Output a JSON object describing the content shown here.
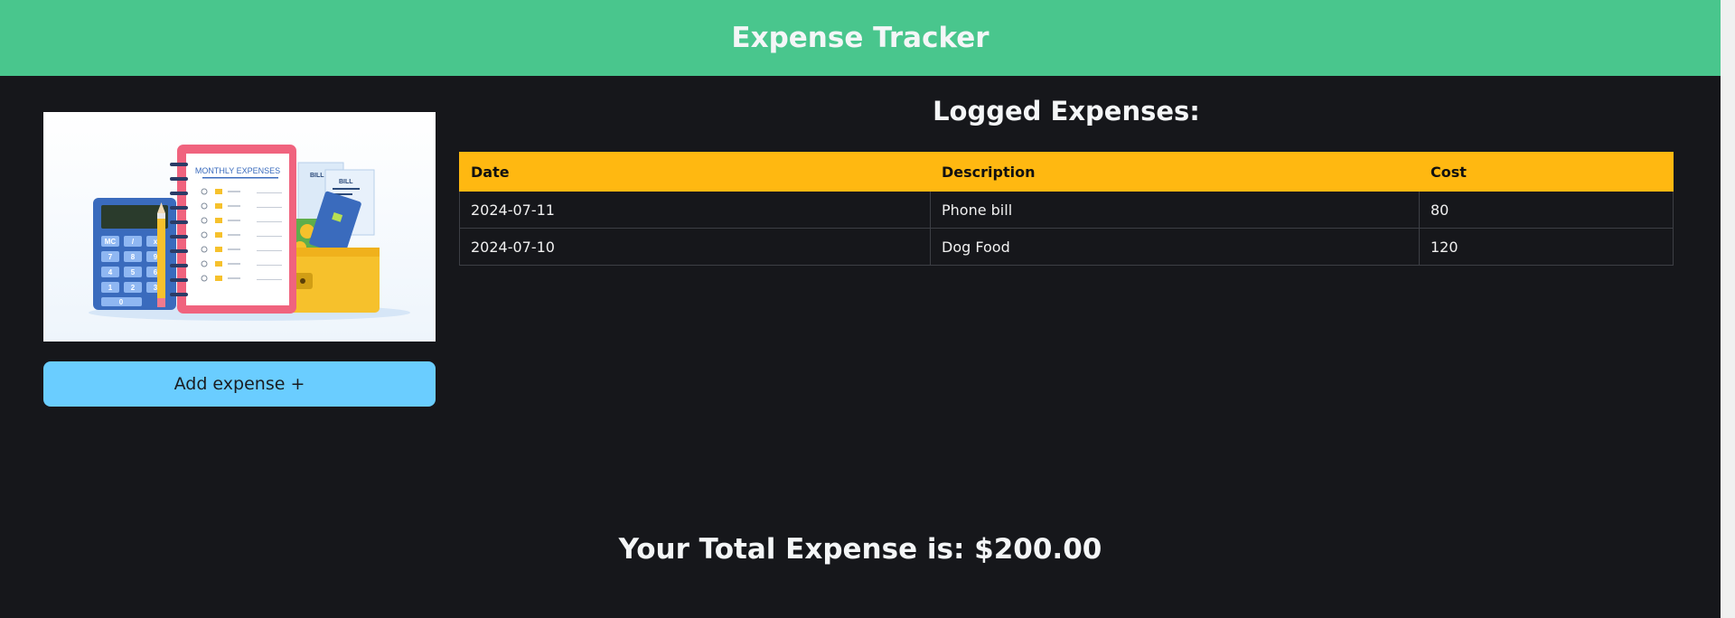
{
  "header": {
    "title": "Expense Tracker"
  },
  "sidebar": {
    "illustration": {
      "notebook_title": "MONTHLY EXPENSES",
      "bill_label_1": "BILL",
      "bill_label_2": "BILL",
      "calc_keys": [
        "MC",
        "/",
        "x",
        "7",
        "8",
        "9",
        "4",
        "5",
        "6",
        "1",
        "2",
        "3",
        "0"
      ]
    },
    "add_button_label": "Add expense +"
  },
  "main": {
    "section_title": "Logged Expenses:",
    "table": {
      "headers": [
        "Date",
        "Description",
        "Cost"
      ],
      "rows": [
        [
          "2024-07-11",
          "Phone bill",
          "80"
        ],
        [
          "2024-07-10",
          "Dog Food",
          "120"
        ]
      ]
    }
  },
  "footer": {
    "total_text": "Your Total Expense is: $200.00"
  },
  "colors": {
    "header_bg": "#49c68d",
    "page_bg": "#16171b",
    "table_header_bg": "#ffb811",
    "button_bg": "#6acdff"
  }
}
